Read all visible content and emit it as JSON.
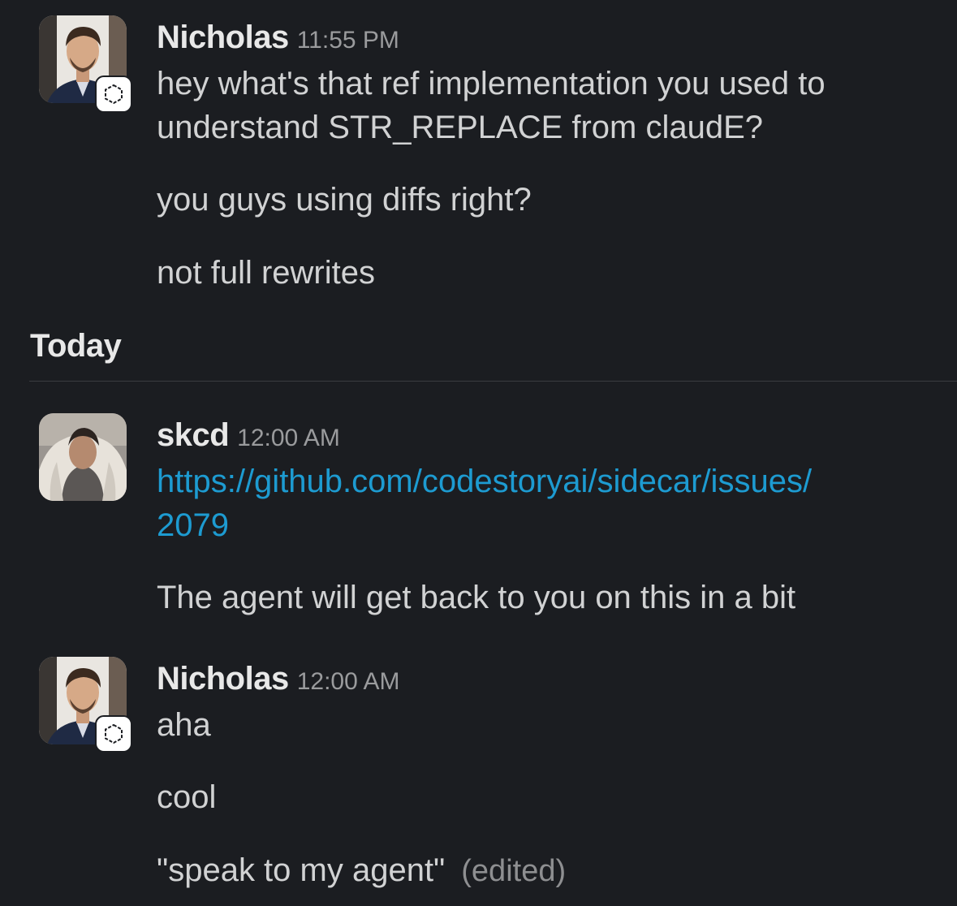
{
  "messages_before": [
    {
      "author": "Nicholas",
      "time": "11:55 PM",
      "avatar_icon": "nicholas-avatar",
      "badge_icon": "hexagon-app-icon",
      "lines": [
        "hey what's that ref implementation you used to",
        "understand STR_REPLACE from claudE?",
        "you guys using diffs right?",
        "not full rewrites"
      ]
    }
  ],
  "day_divider": {
    "label": "Today"
  },
  "messages_today": [
    {
      "author": "skcd",
      "time": "12:00 AM",
      "avatar_icon": "skcd-avatar",
      "link_lines": [
        "https://github.com/codestoryai/sidecar/issues/",
        "2079"
      ],
      "lines": [
        "The agent will get back to you on this in a bit"
      ]
    },
    {
      "author": "Nicholas",
      "time": "12:00 AM",
      "avatar_icon": "nicholas-avatar",
      "badge_icon": "hexagon-app-icon",
      "lines": [
        "aha",
        "cool",
        "\"speak to my agent\""
      ],
      "edited_label": "(edited)"
    }
  ],
  "colors": {
    "background": "#1b1d21",
    "text": "#d1d2d3",
    "link": "#1d9bd1",
    "muted": "#9a9b9d"
  }
}
